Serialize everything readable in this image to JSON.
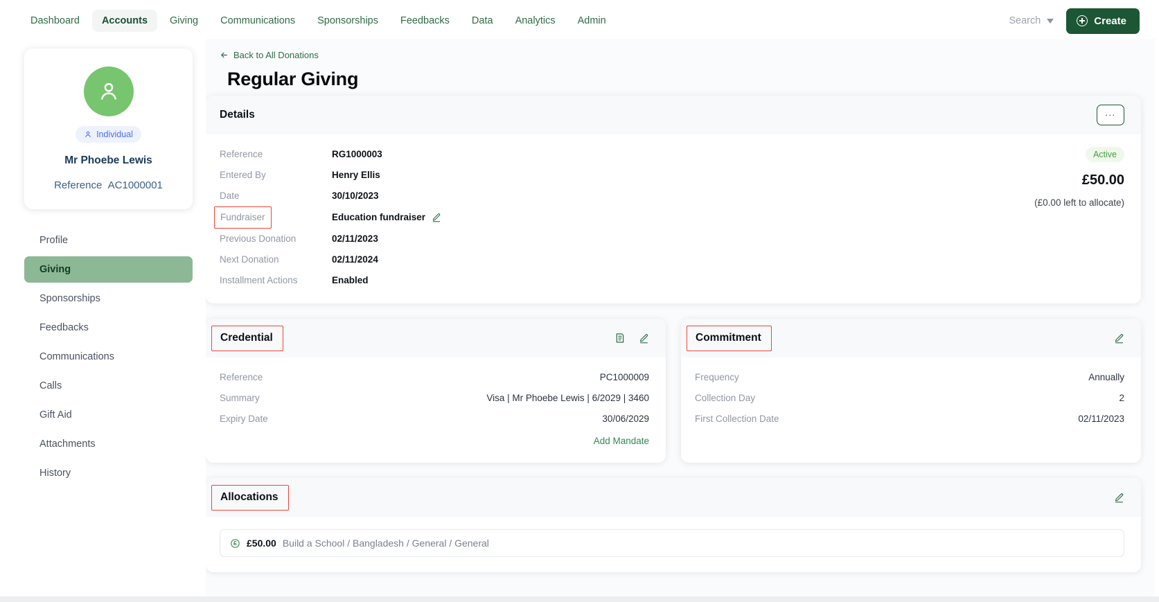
{
  "topnav": {
    "items": [
      {
        "label": "Dashboard",
        "active": false
      },
      {
        "label": "Accounts",
        "active": true
      },
      {
        "label": "Giving",
        "active": false
      },
      {
        "label": "Communications",
        "active": false
      },
      {
        "label": "Sponsorships",
        "active": false
      },
      {
        "label": "Feedbacks",
        "active": false
      },
      {
        "label": "Data",
        "active": false
      },
      {
        "label": "Analytics",
        "active": false
      },
      {
        "label": "Admin",
        "active": false
      }
    ],
    "search_label": "Search",
    "create_label": "Create"
  },
  "profile": {
    "badge_label": "Individual",
    "name": "Mr Phoebe Lewis",
    "reference_label": "Reference",
    "reference_value": "AC1000001"
  },
  "sidenav": {
    "items": [
      {
        "label": "Profile",
        "active": false
      },
      {
        "label": "Giving",
        "active": true
      },
      {
        "label": "Sponsorships",
        "active": false
      },
      {
        "label": "Feedbacks",
        "active": false
      },
      {
        "label": "Communications",
        "active": false
      },
      {
        "label": "Calls",
        "active": false
      },
      {
        "label": "Gift Aid",
        "active": false
      },
      {
        "label": "Attachments",
        "active": false
      },
      {
        "label": "History",
        "active": false
      }
    ]
  },
  "page": {
    "back_label": "Back to All Donations",
    "title": "Regular Giving"
  },
  "details": {
    "title": "Details",
    "more_label": "...",
    "rows": [
      {
        "key": "Reference",
        "value": "RG1000003"
      },
      {
        "key": "Entered By",
        "value": "Henry Ellis"
      },
      {
        "key": "Date",
        "value": "30/10/2023"
      },
      {
        "key": "Fundraiser",
        "value": "Education fundraiser"
      },
      {
        "key": "Previous Donation",
        "value": "02/11/2023"
      },
      {
        "key": "Next Donation",
        "value": "02/11/2024"
      },
      {
        "key": "Installment Actions",
        "value": "Enabled"
      }
    ],
    "status": "Active",
    "amount": "£50.00",
    "amount_sub": "(£0.00 left to allocate)"
  },
  "credential": {
    "title": "Credential",
    "rows": [
      {
        "key": "Reference",
        "value": "PC1000009"
      },
      {
        "key": "Summary",
        "value": "Visa | Mr Phoebe Lewis | 6/2029 | 3460"
      },
      {
        "key": "Expiry Date",
        "value": "30/06/2029"
      }
    ],
    "add_mandate_label": "Add Mandate"
  },
  "commitment": {
    "title": "Commitment",
    "rows": [
      {
        "key": "Frequency",
        "value": "Annually"
      },
      {
        "key": "Collection Day",
        "value": "2"
      },
      {
        "key": "First Collection Date",
        "value": "02/11/2023"
      }
    ]
  },
  "allocations": {
    "title": "Allocations",
    "rows": [
      {
        "amount": "£50.00",
        "description": "Build a School / Bangladesh / General / General"
      }
    ]
  },
  "colors": {
    "brand_green": "#1c5634",
    "accent_green": "#77c56e",
    "active_nav": "#8db896",
    "status_active_text": "#4a9a45",
    "highlight_box": "#f04438",
    "badge_blue": "#4c6ef5"
  }
}
